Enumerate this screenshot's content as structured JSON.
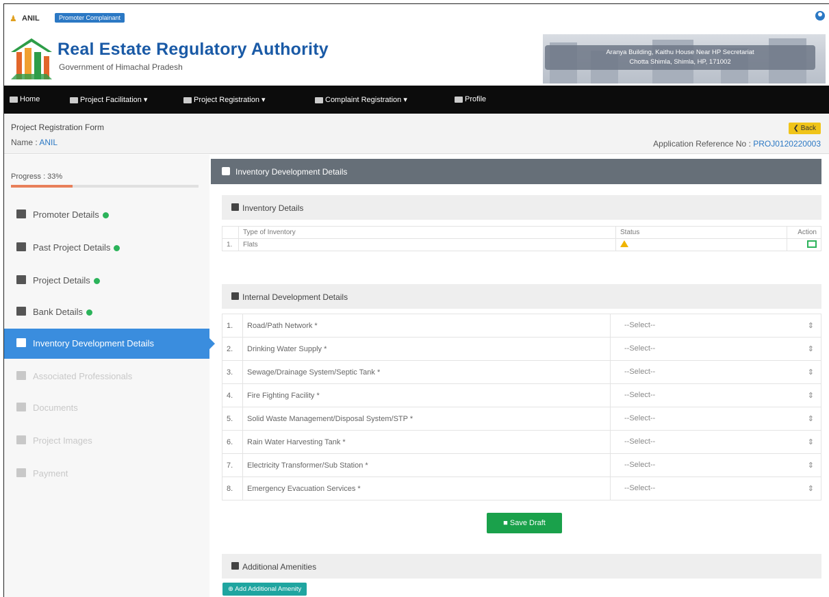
{
  "top": {
    "user_name": "ANIL",
    "role_badge": "Promoter Complainant"
  },
  "header": {
    "title": "Real Estate Regulatory Authority",
    "subtitle": "Government of Himachal Pradesh",
    "address_line1": "Aranya Building, Kaithu House Near HP Secretariat",
    "address_line2": "Chotta Shimla, Shimla, HP, 171002"
  },
  "nav": {
    "home": "Home",
    "facilitation": "Project Facilitation ▾",
    "registration": "Project Registration ▾",
    "complaint": "Complaint Registration ▾",
    "profile": "Profile"
  },
  "page": {
    "form_title": "Project Registration Form",
    "name_label": "Name : ",
    "name_value": "ANIL",
    "back": "Back",
    "ref_label": "Application Reference No : ",
    "ref_value": "PROJ0120220003"
  },
  "sidebar": {
    "progress_label": "Progress : 33%",
    "progress_fraction": 0.33,
    "items": [
      {
        "label": "Promoter Details"
      },
      {
        "label": "Past Project Details"
      },
      {
        "label": "Project Details"
      },
      {
        "label": "Bank Details"
      },
      {
        "label": "Inventory Development Details"
      },
      {
        "label": "Associated Professionals"
      },
      {
        "label": "Documents"
      },
      {
        "label": "Project Images"
      },
      {
        "label": "Payment"
      }
    ]
  },
  "main": {
    "section_title": "Inventory Development Details",
    "inventory": {
      "title": "Inventory Details",
      "headers": [
        "Type of Inventory",
        "Status",
        "Action"
      ],
      "rows": [
        {
          "sn": "1.",
          "type": "Flats"
        }
      ]
    },
    "internal": {
      "title": "Internal Development Details",
      "select_placeholder": "--Select--",
      "rows": [
        {
          "sn": "1.",
          "label": "Road/Path Network *"
        },
        {
          "sn": "2.",
          "label": "Drinking Water Supply *"
        },
        {
          "sn": "3.",
          "label": "Sewage/Drainage System/Septic Tank *"
        },
        {
          "sn": "4.",
          "label": "Fire Fighting Facility *"
        },
        {
          "sn": "5.",
          "label": "Solid Waste Management/Disposal System/STP *"
        },
        {
          "sn": "6.",
          "label": "Rain Water Harvesting Tank *"
        },
        {
          "sn": "7.",
          "label": "Electricity Transformer/Sub Station *"
        },
        {
          "sn": "8.",
          "label": "Emergency Evacuation Services *"
        }
      ]
    },
    "save_draft": "Save Draft",
    "amenities_title": "Additional Amenities",
    "add_amenity": "Add Additional Amenity"
  }
}
